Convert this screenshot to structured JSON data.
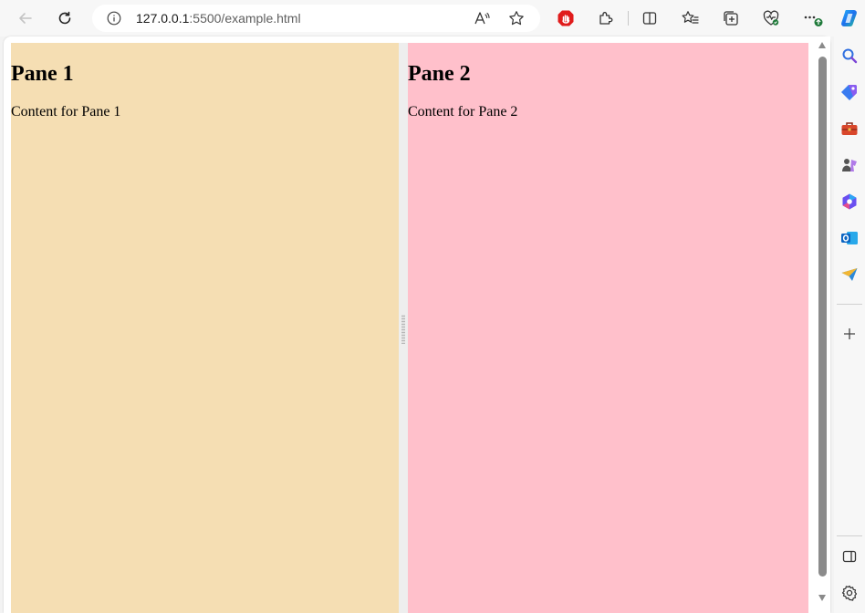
{
  "browser": {
    "address_bar": {
      "url_host": "127.0.0.1",
      "url_rest": ":5500/example.html"
    },
    "toolbar_icons": [
      "back-icon",
      "refresh-icon",
      "site-info-icon",
      "read-aloud-icon",
      "favorite-star-icon",
      "adblock-icon",
      "extensions-icon",
      "split-screen-icon",
      "favorites-icon",
      "collections-icon",
      "browser-essentials-icon",
      "more-menu-icon",
      "copilot-icon"
    ],
    "sidebar_icons": [
      "search-icon",
      "shopping-icon",
      "tools-icon",
      "games-icon",
      "microsoft365-icon",
      "outlook-icon",
      "drop-icon",
      "add-icon",
      "hide-sidebar-icon",
      "settings-icon"
    ]
  },
  "page": {
    "panes": [
      {
        "heading": "Pane 1",
        "content": "Content for Pane 1",
        "background": "#f5deb3"
      },
      {
        "heading": "Pane 2",
        "content": "Content for Pane 2",
        "background": "#ffc0cb"
      }
    ]
  }
}
